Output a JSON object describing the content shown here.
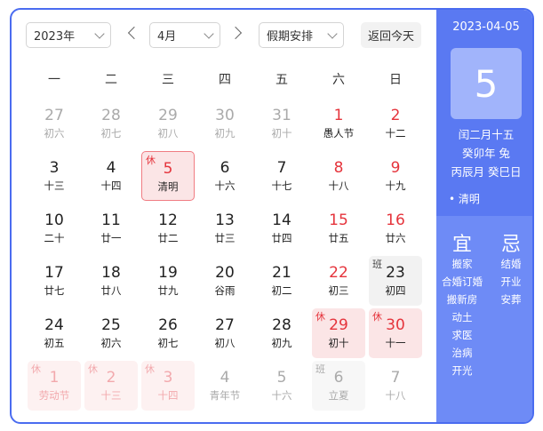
{
  "header": {
    "year_value": "2023年",
    "month_value": "4月",
    "holiday_value": "假期安排",
    "today_label": "返回今天"
  },
  "weekdays": [
    "一",
    "二",
    "三",
    "四",
    "五",
    "六",
    "日"
  ],
  "colors": {
    "accent": "#5a79f2",
    "holiday_red": "#e5343c"
  },
  "weeks": [
    [
      {
        "num": "27",
        "lunar": "初六",
        "style": "gray"
      },
      {
        "num": "28",
        "lunar": "初七",
        "style": "gray"
      },
      {
        "num": "29",
        "lunar": "初八",
        "style": "gray"
      },
      {
        "num": "30",
        "lunar": "初九",
        "style": "gray"
      },
      {
        "num": "31",
        "lunar": "初十",
        "style": "gray"
      },
      {
        "num": "1",
        "lunar": "愚人节",
        "style": "red"
      },
      {
        "num": "2",
        "lunar": "十二",
        "style": "red"
      }
    ],
    [
      {
        "num": "3",
        "lunar": "十三",
        "style": "dark"
      },
      {
        "num": "4",
        "lunar": "十四",
        "style": "dark"
      },
      {
        "num": "5",
        "lunar": "清明",
        "style": "holiday selected",
        "tag": "休"
      },
      {
        "num": "6",
        "lunar": "十六",
        "style": "dark"
      },
      {
        "num": "7",
        "lunar": "十七",
        "style": "dark"
      },
      {
        "num": "8",
        "lunar": "十八",
        "style": "red"
      },
      {
        "num": "9",
        "lunar": "十九",
        "style": "red"
      }
    ],
    [
      {
        "num": "10",
        "lunar": "二十",
        "style": "dark"
      },
      {
        "num": "11",
        "lunar": "廿一",
        "style": "dark"
      },
      {
        "num": "12",
        "lunar": "廿二",
        "style": "dark"
      },
      {
        "num": "13",
        "lunar": "廿三",
        "style": "dark"
      },
      {
        "num": "14",
        "lunar": "廿四",
        "style": "dark"
      },
      {
        "num": "15",
        "lunar": "廿五",
        "style": "red"
      },
      {
        "num": "16",
        "lunar": "廿六",
        "style": "red"
      }
    ],
    [
      {
        "num": "17",
        "lunar": "廿七",
        "style": "dark"
      },
      {
        "num": "18",
        "lunar": "廿八",
        "style": "dark"
      },
      {
        "num": "19",
        "lunar": "廿九",
        "style": "dark"
      },
      {
        "num": "20",
        "lunar": "谷雨",
        "style": "dark"
      },
      {
        "num": "21",
        "lunar": "初二",
        "style": "dark"
      },
      {
        "num": "22",
        "lunar": "初三",
        "style": "red"
      },
      {
        "num": "23",
        "lunar": "初四",
        "style": "workday",
        "tag": "班"
      }
    ],
    [
      {
        "num": "24",
        "lunar": "初五",
        "style": "dark"
      },
      {
        "num": "25",
        "lunar": "初六",
        "style": "dark"
      },
      {
        "num": "26",
        "lunar": "初七",
        "style": "dark"
      },
      {
        "num": "27",
        "lunar": "初八",
        "style": "dark"
      },
      {
        "num": "28",
        "lunar": "初九",
        "style": "dark"
      },
      {
        "num": "29",
        "lunar": "初十",
        "style": "holiday",
        "tag": "休"
      },
      {
        "num": "30",
        "lunar": "十一",
        "style": "holiday",
        "tag": "休"
      }
    ],
    [
      {
        "num": "1",
        "lunar": "劳动节",
        "style": "holiday faded",
        "tag": "休"
      },
      {
        "num": "2",
        "lunar": "十三",
        "style": "holiday faded",
        "tag": "休"
      },
      {
        "num": "3",
        "lunar": "十四",
        "style": "holiday faded",
        "tag": "休"
      },
      {
        "num": "4",
        "lunar": "青年节",
        "style": "gray"
      },
      {
        "num": "5",
        "lunar": "十六",
        "style": "gray"
      },
      {
        "num": "6",
        "lunar": "立夏",
        "style": "workday faded",
        "tag": "班"
      },
      {
        "num": "7",
        "lunar": "十八",
        "style": "gray"
      }
    ]
  ],
  "sidebar": {
    "date": "2023-04-05",
    "day": "5",
    "lunar_date": "闰二月十五",
    "year_ganzhi": "癸卯年 兔",
    "month_day_ganzhi": "丙辰月 癸巳日",
    "festival": "清明",
    "yi_title": "宜",
    "ji_title": "忌",
    "yi_items": [
      "搬家",
      "合婚订婚",
      "搬新房",
      "动土",
      "求医",
      "治病",
      "开光"
    ],
    "ji_items": [
      "结婚",
      "开业",
      "安葬"
    ]
  }
}
